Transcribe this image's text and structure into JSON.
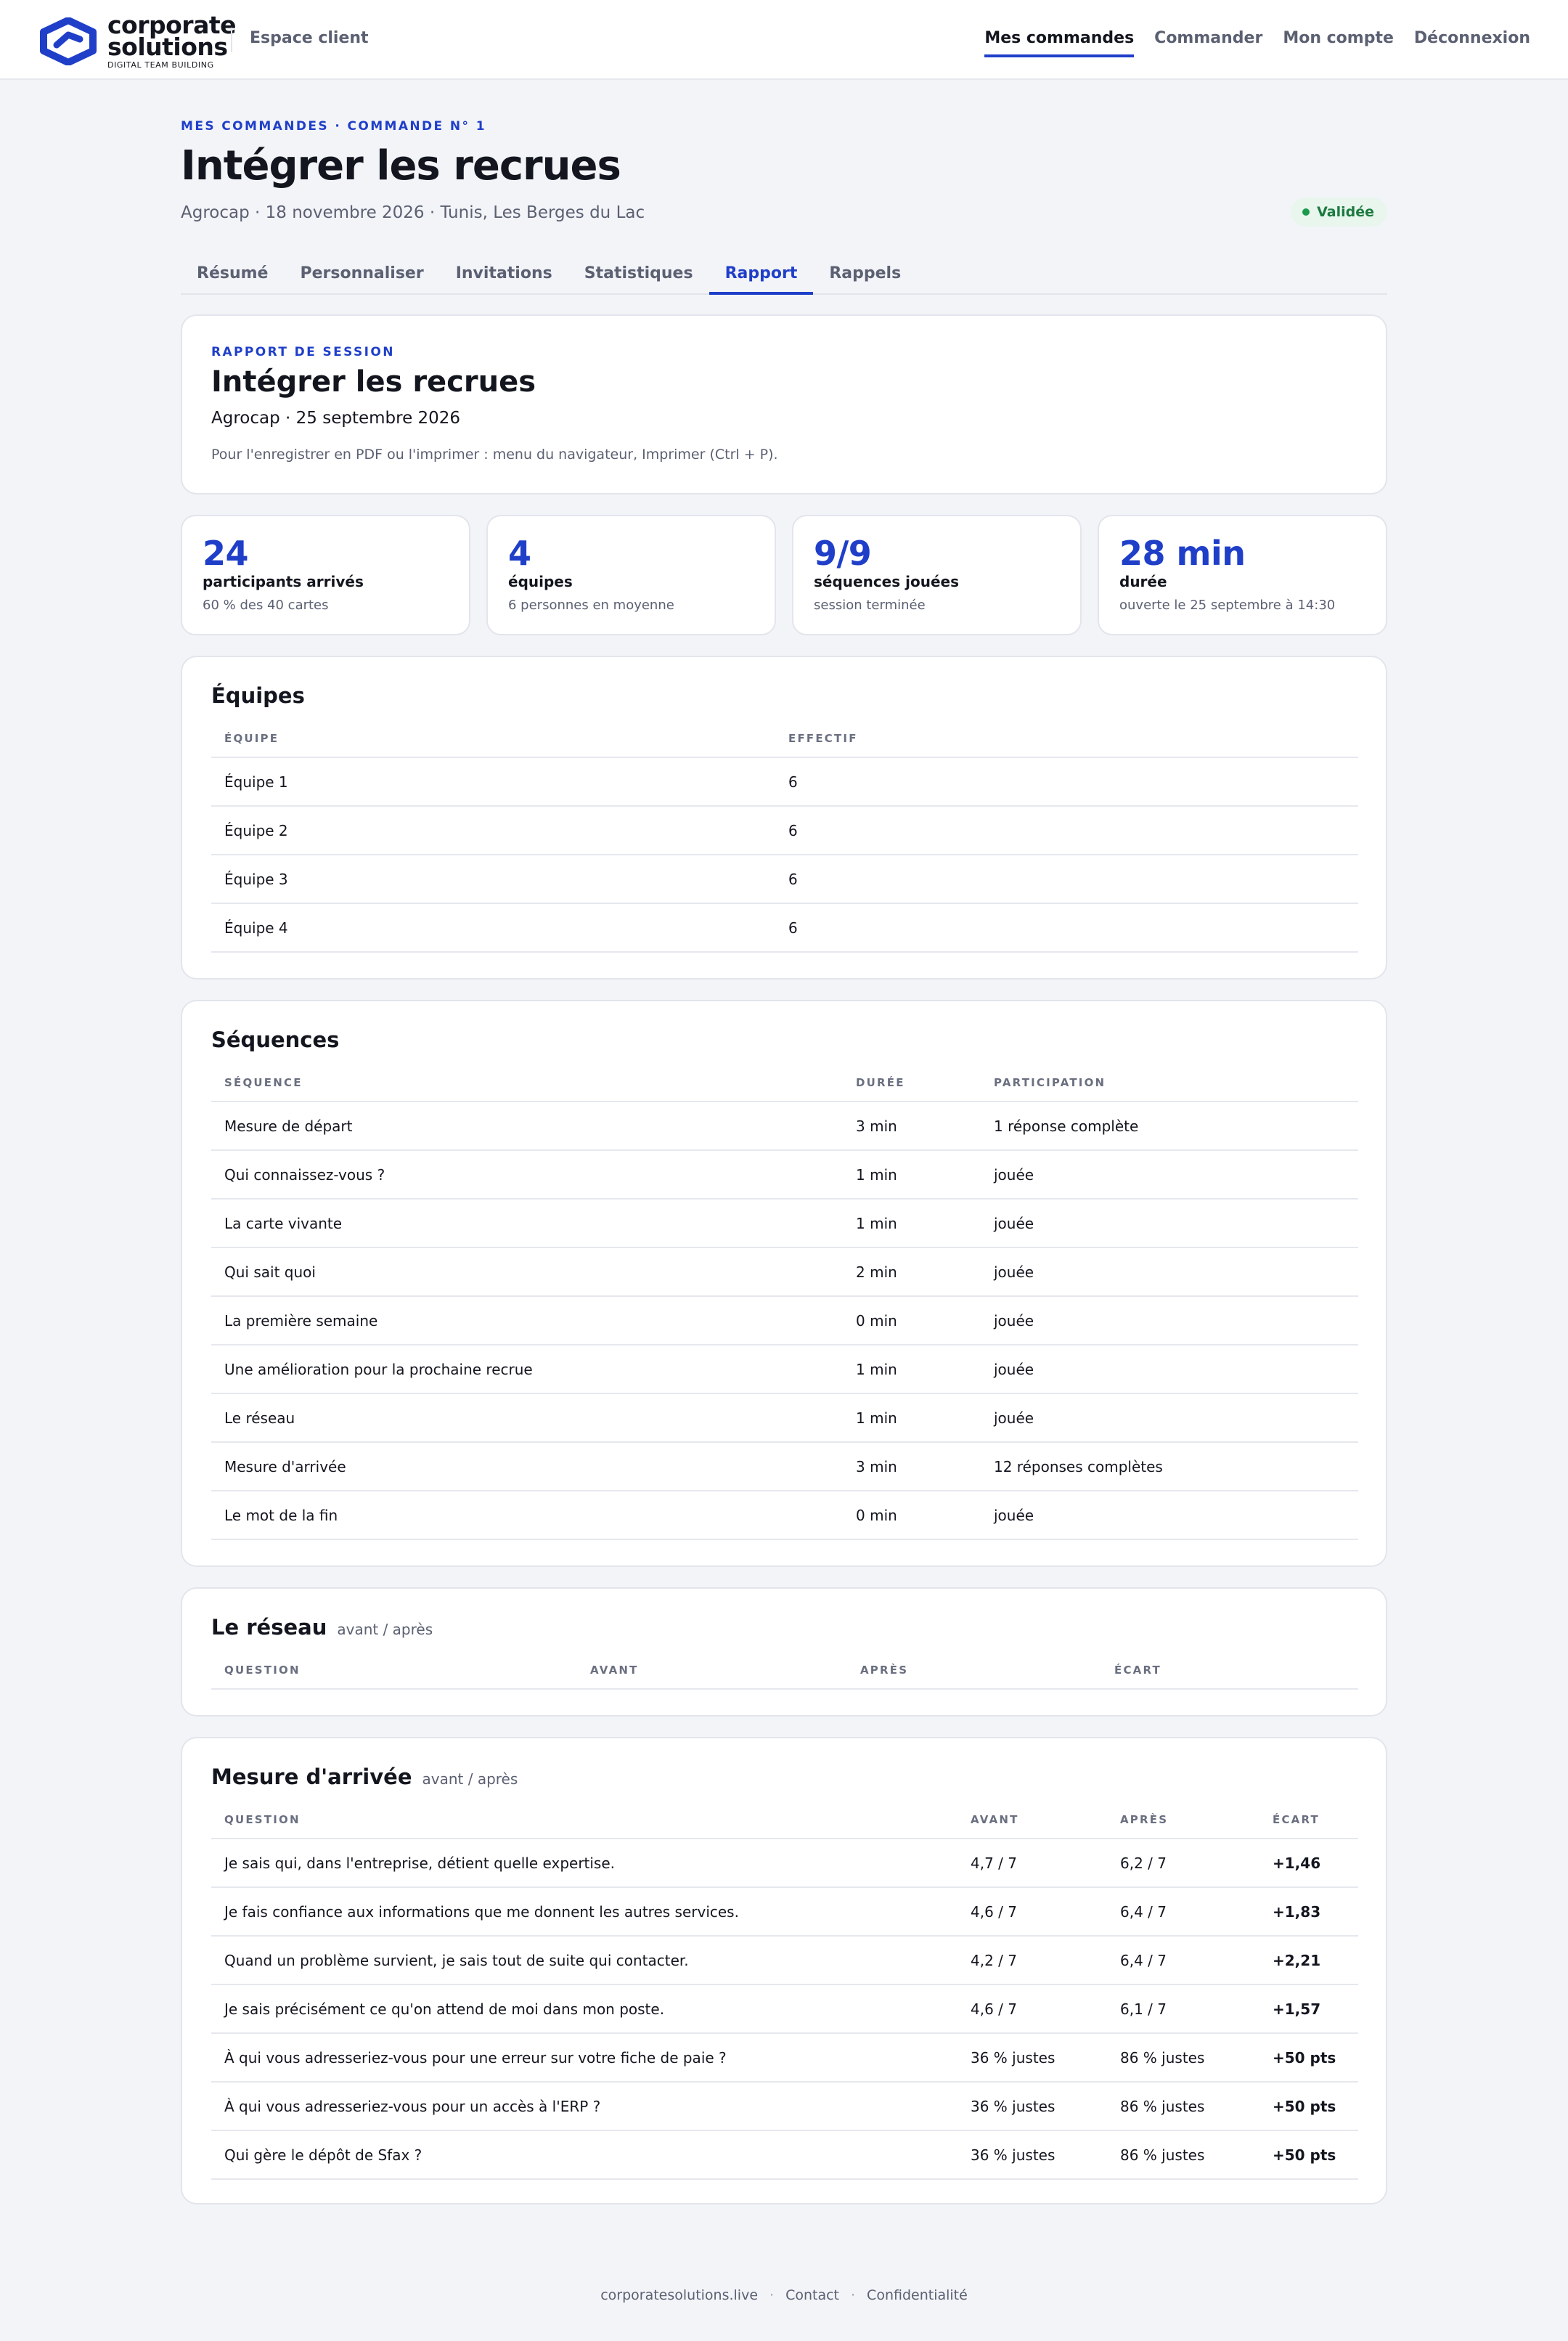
{
  "brand": {
    "line1": "corporate",
    "line2": "solutions",
    "tagline": "DIGITAL TEAM BUILDING",
    "area": "Espace client"
  },
  "nav": {
    "items": [
      "Mes commandes",
      "Commander",
      "Mon compte",
      "Déconnexion"
    ],
    "active_index": 0
  },
  "header": {
    "breadcrumb": "MES COMMANDES · COMMANDE N° 1",
    "title": "Intégrer les recrues",
    "meta": "Agrocap · 18 novembre 2026 · Tunis, Les Berges du Lac",
    "status": "Validée"
  },
  "tabs": {
    "items": [
      "Résumé",
      "Personnaliser",
      "Invitations",
      "Statistiques",
      "Rapport",
      "Rappels"
    ],
    "active_index": 4
  },
  "report": {
    "eyebrow": "RAPPORT DE SESSION",
    "title": "Intégrer les recrues",
    "subtitle": "Agrocap · 25 septembre 2026",
    "note": "Pour l'enregistrer en PDF ou l'imprimer : menu du navigateur, Imprimer (Ctrl + P)."
  },
  "stats": [
    {
      "value": "24",
      "label": "participants arrivés",
      "sub": "60 % des 40 cartes"
    },
    {
      "value": "4",
      "label": "équipes",
      "sub": "6 personnes en moyenne"
    },
    {
      "value": "9/9",
      "label": "séquences jouées",
      "sub": "session terminée"
    },
    {
      "value": "28 min",
      "label": "durée",
      "sub": "ouverte le 25 septembre à 14:30"
    }
  ],
  "teams": {
    "title": "Équipes",
    "headers": [
      "ÉQUIPE",
      "EFFECTIF"
    ],
    "rows": [
      [
        "Équipe 1",
        "6"
      ],
      [
        "Équipe 2",
        "6"
      ],
      [
        "Équipe 3",
        "6"
      ],
      [
        "Équipe 4",
        "6"
      ]
    ]
  },
  "sequences": {
    "title": "Séquences",
    "headers": [
      "SÉQUENCE",
      "DURÉE",
      "PARTICIPATION"
    ],
    "rows": [
      [
        "Mesure de départ",
        "3 min",
        "1 réponse complète"
      ],
      [
        "Qui connaissez-vous ?",
        "1 min",
        "jouée"
      ],
      [
        "La carte vivante",
        "1 min",
        "jouée"
      ],
      [
        "Qui sait quoi",
        "2 min",
        "jouée"
      ],
      [
        "La première semaine",
        "0 min",
        "jouée"
      ],
      [
        "Une amélioration pour la prochaine recrue",
        "1 min",
        "jouée"
      ],
      [
        "Le réseau",
        "1 min",
        "jouée"
      ],
      [
        "Mesure d'arrivée",
        "3 min",
        "12 réponses complètes"
      ],
      [
        "Le mot de la fin",
        "0 min",
        "jouée"
      ]
    ]
  },
  "network": {
    "title": "Le réseau",
    "hint": "avant / après",
    "headers": [
      "QUESTION",
      "AVANT",
      "APRÈS",
      "ÉCART"
    ]
  },
  "arrival": {
    "title": "Mesure d'arrivée",
    "hint": "avant / après",
    "headers": [
      "QUESTION",
      "AVANT",
      "APRÈS",
      "ÉCART"
    ],
    "rows": [
      [
        "Je sais qui, dans l'entreprise, détient quelle expertise.",
        "4,7 / 7",
        "6,2 / 7",
        "+1,46"
      ],
      [
        "Je fais confiance aux informations que me donnent les autres services.",
        "4,6 / 7",
        "6,4 / 7",
        "+1,83"
      ],
      [
        "Quand un problème survient, je sais tout de suite qui contacter.",
        "4,2 / 7",
        "6,4 / 7",
        "+2,21"
      ],
      [
        "Je sais précisément ce qu'on attend de moi dans mon poste.",
        "4,6 / 7",
        "6,1 / 7",
        "+1,57"
      ],
      [
        "À qui vous adresseriez-vous pour une erreur sur votre fiche de paie ?",
        "36 % justes",
        "86 % justes",
        "+50 pts"
      ],
      [
        "À qui vous adresseriez-vous pour un accès à l'ERP ?",
        "36 % justes",
        "86 % justes",
        "+50 pts"
      ],
      [
        "Qui gère le dépôt de Sfax ?",
        "36 % justes",
        "86 % justes",
        "+50 pts"
      ]
    ]
  },
  "footer": {
    "links": [
      "corporatesolutions.live",
      "Contact",
      "Confidentialité"
    ]
  }
}
